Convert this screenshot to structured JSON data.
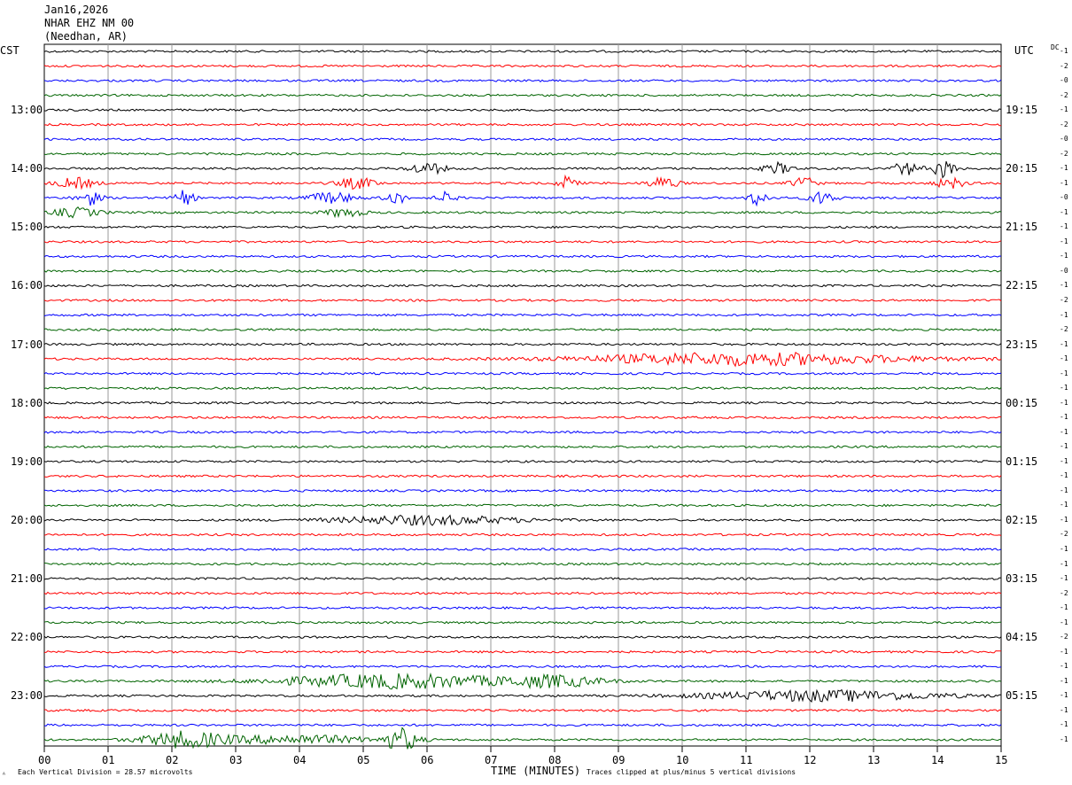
{
  "header": {
    "date": "Jan16,2026",
    "station": "NHAR EHZ NM 00",
    "location": "(Needhan, AR)",
    "left_tz": "CST",
    "right_tz": "UTC",
    "dc_label": "DC"
  },
  "footer": {
    "scale_text": "Each Vertical Division =   28.57 microvolts",
    "clip_text": "Traces clipped at plus/minus 5 vertical divisions",
    "corner_mark": "ᴬ"
  },
  "chart_data": {
    "type": "line",
    "title": "",
    "xlabel": "TIME (MINUTES)",
    "ylabel": "",
    "xlim": [
      0,
      15
    ],
    "x_ticks": [
      "00",
      "01",
      "02",
      "03",
      "04",
      "05",
      "06",
      "07",
      "08",
      "09",
      "10",
      "11",
      "12",
      "13",
      "14",
      "15"
    ],
    "rows_per_hour": 4,
    "row_count": 48,
    "trace_colors": [
      "#000000",
      "#ff0000",
      "#0000ff",
      "#006400"
    ],
    "left_hour_labels": [
      {
        "row": 4,
        "label": "13:00"
      },
      {
        "row": 8,
        "label": "14:00"
      },
      {
        "row": 12,
        "label": "15:00"
      },
      {
        "row": 16,
        "label": "16:00"
      },
      {
        "row": 20,
        "label": "17:00"
      },
      {
        "row": 24,
        "label": "18:00"
      },
      {
        "row": 28,
        "label": "19:00"
      },
      {
        "row": 32,
        "label": "20:00"
      },
      {
        "row": 36,
        "label": "21:00"
      },
      {
        "row": 40,
        "label": "22:00"
      },
      {
        "row": 44,
        "label": "23:00"
      }
    ],
    "right_hour_labels": [
      {
        "row": 4,
        "label": "19:15"
      },
      {
        "row": 8,
        "label": "20:15"
      },
      {
        "row": 12,
        "label": "21:15"
      },
      {
        "row": 16,
        "label": "22:15"
      },
      {
        "row": 20,
        "label": "23:15"
      },
      {
        "row": 24,
        "label": "00:15"
      },
      {
        "row": 28,
        "label": "01:15"
      },
      {
        "row": 32,
        "label": "02:15"
      },
      {
        "row": 36,
        "label": "03:15"
      },
      {
        "row": 40,
        "label": "04:15"
      },
      {
        "row": 44,
        "label": "05:15"
      }
    ],
    "dc_offsets": [
      "-1",
      "-2",
      "-0",
      "-2",
      "-1",
      "-2",
      "-0",
      "-2",
      "-1",
      "-1",
      "-0",
      "-1",
      "-1",
      "-1",
      "-1",
      "-0",
      "-1",
      "-2",
      "-1",
      "-2",
      "-1",
      "-1",
      "-1",
      "-1",
      "-1",
      "-1",
      "-1",
      "-1",
      "-1",
      "-1",
      "-1",
      "-1",
      "-1",
      "-2",
      "-1",
      "-1",
      "-1",
      "-2",
      "-1",
      "-1",
      "-2",
      "-1",
      "-1",
      "-1",
      "-1",
      "-1",
      "-1",
      "-1"
    ],
    "bursts": [
      {
        "row": 8,
        "x": 6.0,
        "amp": 6,
        "width": 0.4
      },
      {
        "row": 8,
        "x": 11.5,
        "amp": 6,
        "width": 0.3
      },
      {
        "row": 8,
        "x": 13.5,
        "amp": 7,
        "width": 0.3
      },
      {
        "row": 8,
        "x": 14.1,
        "amp": 10,
        "width": 0.25
      },
      {
        "row": 9,
        "x": 0.5,
        "amp": 6,
        "width": 0.4
      },
      {
        "row": 9,
        "x": 4.9,
        "amp": 6,
        "width": 0.4
      },
      {
        "row": 9,
        "x": 8.2,
        "amp": 8,
        "width": 0.2
      },
      {
        "row": 9,
        "x": 9.7,
        "amp": 7,
        "width": 0.3
      },
      {
        "row": 9,
        "x": 11.9,
        "amp": 7,
        "width": 0.25
      },
      {
        "row": 9,
        "x": 14.2,
        "amp": 6,
        "width": 0.3
      },
      {
        "row": 10,
        "x": 0.7,
        "amp": 8,
        "width": 0.25
      },
      {
        "row": 10,
        "x": 2.2,
        "amp": 8,
        "width": 0.2
      },
      {
        "row": 10,
        "x": 4.5,
        "amp": 6,
        "width": 0.5
      },
      {
        "row": 10,
        "x": 5.5,
        "amp": 8,
        "width": 0.2
      },
      {
        "row": 10,
        "x": 6.3,
        "amp": 6,
        "width": 0.2
      },
      {
        "row": 10,
        "x": 11.2,
        "amp": 9,
        "width": 0.2
      },
      {
        "row": 10,
        "x": 12.2,
        "amp": 7,
        "width": 0.3
      },
      {
        "row": 11,
        "x": 0.5,
        "amp": 5,
        "width": 0.5
      },
      {
        "row": 11,
        "x": 4.7,
        "amp": 5,
        "width": 0.4
      },
      {
        "row": 21,
        "x": 11.0,
        "amp": 7,
        "width": 3.5
      },
      {
        "row": 32,
        "x": 6.0,
        "amp": 5,
        "width": 2.0
      },
      {
        "row": 43,
        "x": 5.5,
        "amp": 8,
        "width": 2.5
      },
      {
        "row": 43,
        "x": 8.0,
        "amp": 6,
        "width": 1.0
      },
      {
        "row": 44,
        "x": 12.2,
        "amp": 6,
        "width": 2.5
      },
      {
        "row": 47,
        "x": 2.2,
        "amp": 9,
        "width": 0.9
      },
      {
        "row": 47,
        "x": 5.6,
        "amp": 13,
        "width": 0.35
      },
      {
        "row": 47,
        "x": 4.0,
        "amp": 5,
        "width": 1.5
      }
    ]
  }
}
